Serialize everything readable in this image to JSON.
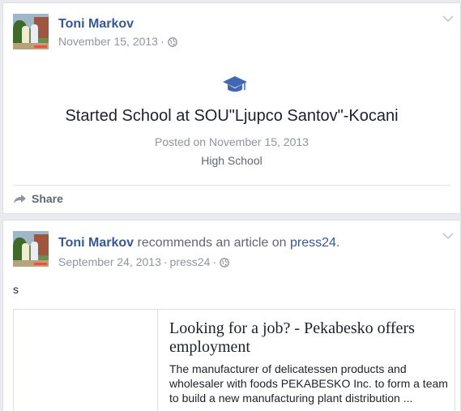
{
  "post1": {
    "author": "Toni Markov",
    "date": "November 15, 2013",
    "separator": "·",
    "privacy_icon": "globe-icon",
    "life_event": {
      "icon": "graduation-cap-icon",
      "title": "Started School at SOU\"Ljupco Santov\"-Kocani",
      "posted": "Posted on November 15, 2013",
      "category": "High School"
    },
    "share_label": "Share"
  },
  "post2": {
    "author": "Toni Markov",
    "action": " recommends an article on ",
    "source": "press24",
    "period": ".",
    "date": "September 24, 2013",
    "separator": "·",
    "via": "press24",
    "privacy_icon": "globe-icon",
    "text": "s",
    "article": {
      "title": "Looking for a job? - Pekabesko offers employment",
      "description": "The manufacturer of delicatessen products and wholesaler with foods PEKABESKO Inc. to form a team to build a new manufacturing plant distribution ..."
    }
  },
  "colors": {
    "link": "#365899",
    "meta": "#90949c",
    "icon_blue": "#4267b2",
    "background": "#e9ebee"
  }
}
